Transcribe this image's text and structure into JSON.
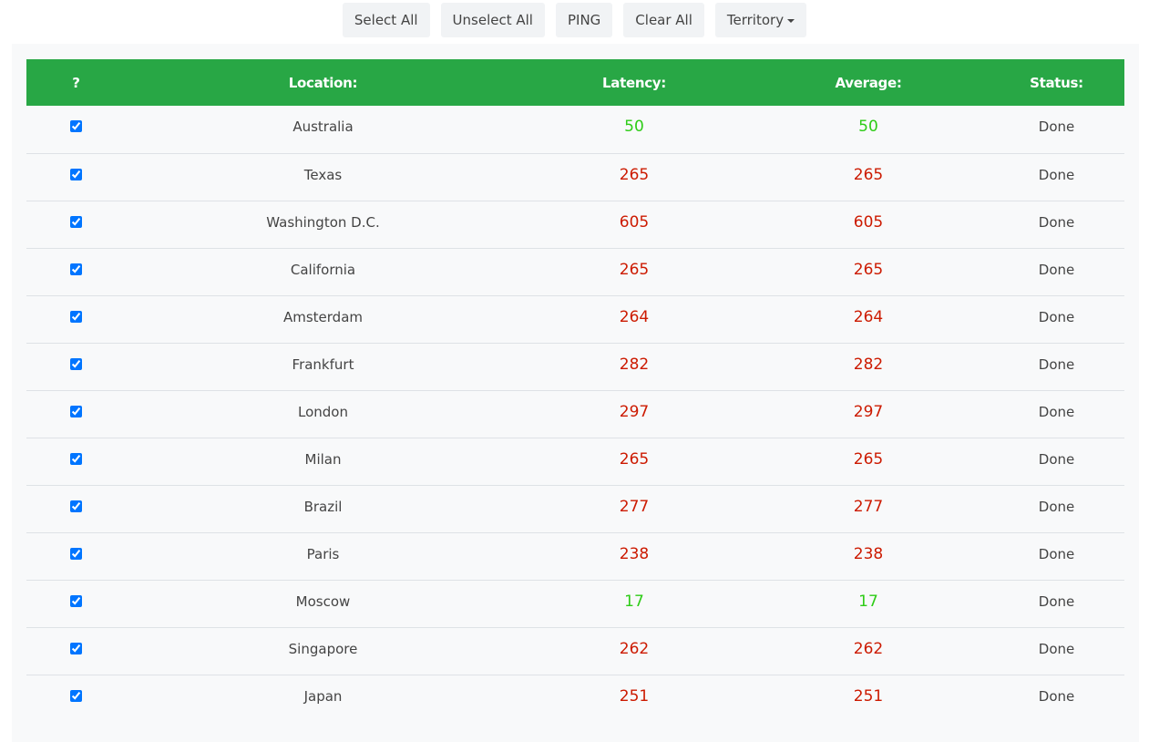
{
  "toolbar": {
    "select_all": "Select All",
    "unselect_all": "Unselect All",
    "ping": "PING",
    "clear_all": "Clear All",
    "territory": "Territory"
  },
  "colors": {
    "good": "#2ecc17",
    "bad": "#cc1a00",
    "header": "#28a745"
  },
  "table": {
    "headers": [
      "?",
      "Location:",
      "Latency:",
      "Average:",
      "Status:"
    ],
    "rows": [
      {
        "checked": true,
        "location": "Australia",
        "latency": "50",
        "average": "50",
        "status": "Done",
        "level": "good"
      },
      {
        "checked": true,
        "location": "Texas",
        "latency": "265",
        "average": "265",
        "status": "Done",
        "level": "bad"
      },
      {
        "checked": true,
        "location": "Washington D.C.",
        "latency": "605",
        "average": "605",
        "status": "Done",
        "level": "bad"
      },
      {
        "checked": true,
        "location": "California",
        "latency": "265",
        "average": "265",
        "status": "Done",
        "level": "bad"
      },
      {
        "checked": true,
        "location": "Amsterdam",
        "latency": "264",
        "average": "264",
        "status": "Done",
        "level": "bad"
      },
      {
        "checked": true,
        "location": "Frankfurt",
        "latency": "282",
        "average": "282",
        "status": "Done",
        "level": "bad"
      },
      {
        "checked": true,
        "location": "London",
        "latency": "297",
        "average": "297",
        "status": "Done",
        "level": "bad"
      },
      {
        "checked": true,
        "location": "Milan",
        "latency": "265",
        "average": "265",
        "status": "Done",
        "level": "bad"
      },
      {
        "checked": true,
        "location": "Brazil",
        "latency": "277",
        "average": "277",
        "status": "Done",
        "level": "bad"
      },
      {
        "checked": true,
        "location": "Paris",
        "latency": "238",
        "average": "238",
        "status": "Done",
        "level": "bad"
      },
      {
        "checked": true,
        "location": "Moscow",
        "latency": "17",
        "average": "17",
        "status": "Done",
        "level": "good"
      },
      {
        "checked": true,
        "location": "Singapore",
        "latency": "262",
        "average": "262",
        "status": "Done",
        "level": "bad"
      },
      {
        "checked": true,
        "location": "Japan",
        "latency": "251",
        "average": "251",
        "status": "Done",
        "level": "bad"
      }
    ]
  }
}
